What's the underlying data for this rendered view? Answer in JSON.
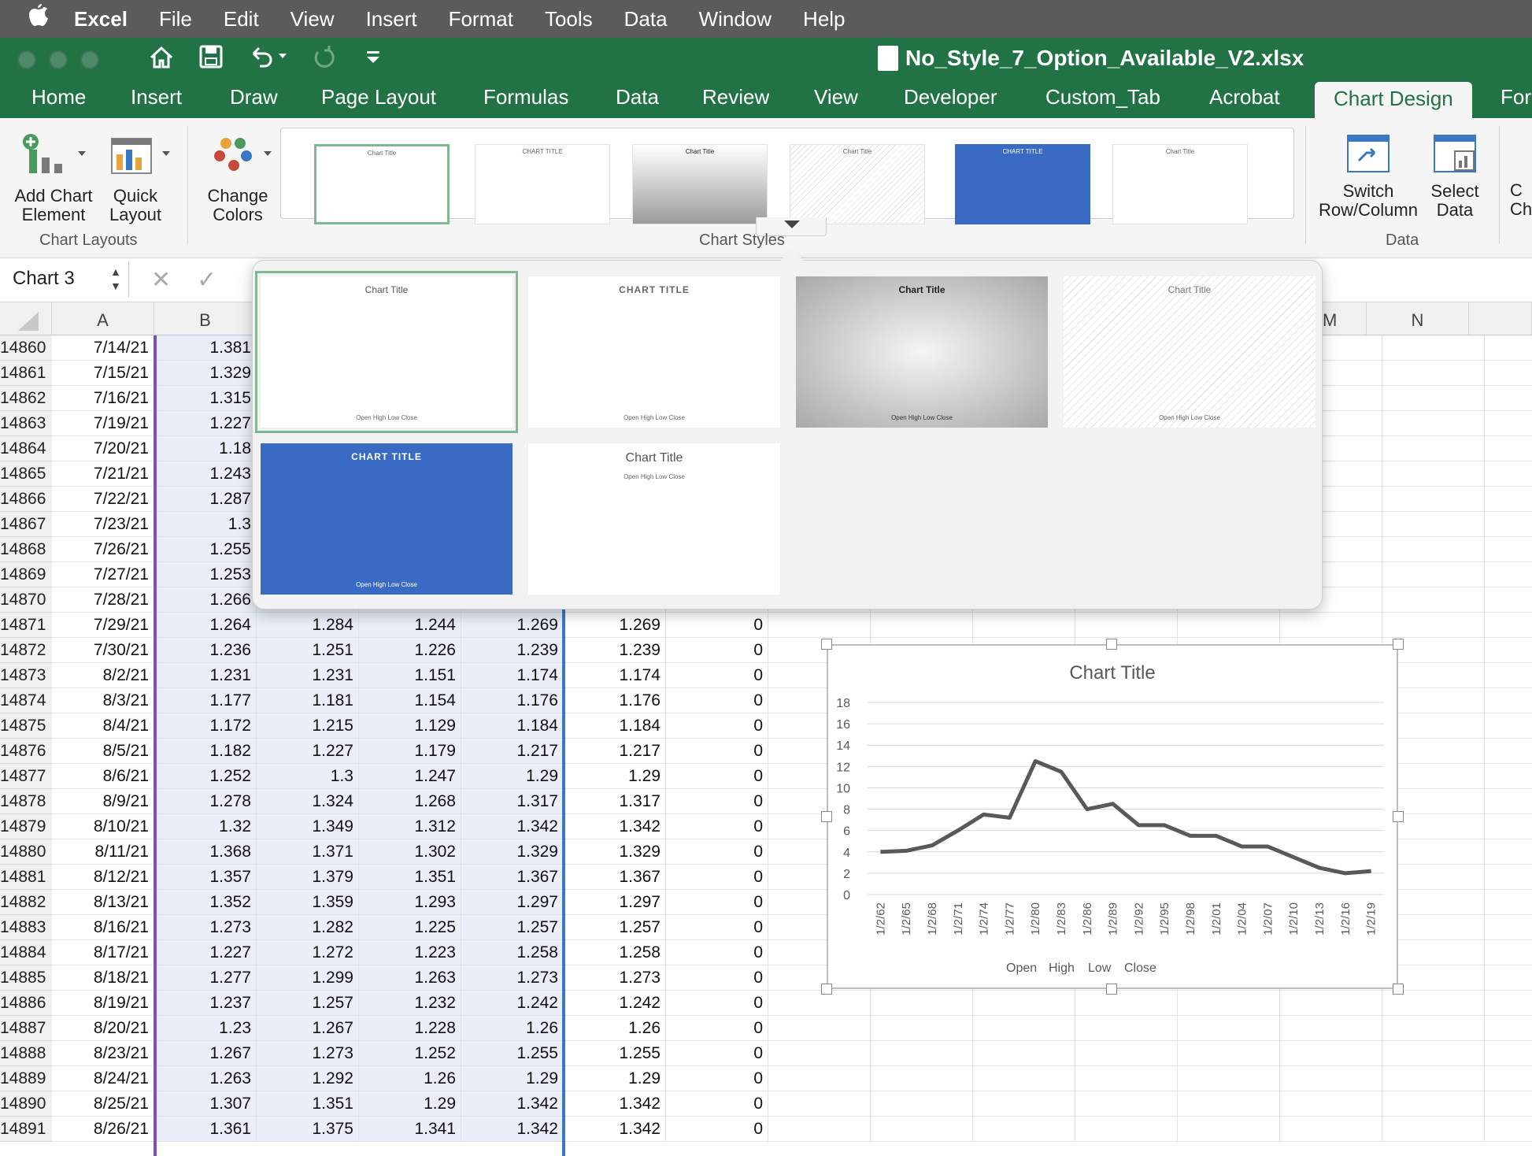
{
  "menubar": {
    "apple": "",
    "items": [
      "Excel",
      "File",
      "Edit",
      "View",
      "Insert",
      "Format",
      "Tools",
      "Data",
      "Window",
      "Help"
    ]
  },
  "titlebar": {
    "doc_title": "No_Style_7_Option_Available_V2.xlsx"
  },
  "tabs": [
    "Home",
    "Insert",
    "Draw",
    "Page Layout",
    "Formulas",
    "Data",
    "Review",
    "View",
    "Developer",
    "Custom_Tab",
    "Acrobat",
    "Chart Design",
    "For"
  ],
  "ribbon": {
    "add_chart_element": "Add Chart Element",
    "quick_layout": "Quick Layout",
    "change_colors": "Change Colors",
    "chart_layouts_label": "Chart Layouts",
    "chart_styles_label": "Chart Styles",
    "switch_row_col": "Switch Row/Column",
    "select_data": "Select Data",
    "data_label": "Data",
    "partial": "C Ch"
  },
  "formula_bar": {
    "name_box": "Chart 3",
    "cancel": "✕",
    "enter": "✓"
  },
  "columns": [
    "A",
    "B",
    "M",
    "N"
  ],
  "rows": [
    {
      "r": "14860",
      "a": "7/14/21",
      "b": "1.381"
    },
    {
      "r": "14861",
      "a": "7/15/21",
      "b": "1.329"
    },
    {
      "r": "14862",
      "a": "7/16/21",
      "b": "1.315"
    },
    {
      "r": "14863",
      "a": "7/19/21",
      "b": "1.227"
    },
    {
      "r": "14864",
      "a": "7/20/21",
      "b": "1.18"
    },
    {
      "r": "14865",
      "a": "7/21/21",
      "b": "1.243"
    },
    {
      "r": "14866",
      "a": "7/22/21",
      "b": "1.287"
    },
    {
      "r": "14867",
      "a": "7/23/21",
      "b": "1.3"
    },
    {
      "r": "14868",
      "a": "7/26/21",
      "b": "1.255"
    },
    {
      "r": "14869",
      "a": "7/27/21",
      "b": "1.253"
    },
    {
      "r": "14870",
      "a": "7/28/21",
      "b": "1.266"
    },
    {
      "r": "14871",
      "a": "7/29/21",
      "b": "1.264",
      "c": "1.284",
      "d": "1.244",
      "e": "1.269",
      "f": "1.269",
      "g": "0"
    },
    {
      "r": "14872",
      "a": "7/30/21",
      "b": "1.236",
      "c": "1.251",
      "d": "1.226",
      "e": "1.239",
      "f": "1.239",
      "g": "0"
    },
    {
      "r": "14873",
      "a": "8/2/21",
      "b": "1.231",
      "c": "1.231",
      "d": "1.151",
      "e": "1.174",
      "f": "1.174",
      "g": "0"
    },
    {
      "r": "14874",
      "a": "8/3/21",
      "b": "1.177",
      "c": "1.181",
      "d": "1.154",
      "e": "1.176",
      "f": "1.176",
      "g": "0"
    },
    {
      "r": "14875",
      "a": "8/4/21",
      "b": "1.172",
      "c": "1.215",
      "d": "1.129",
      "e": "1.184",
      "f": "1.184",
      "g": "0"
    },
    {
      "r": "14876",
      "a": "8/5/21",
      "b": "1.182",
      "c": "1.227",
      "d": "1.179",
      "e": "1.217",
      "f": "1.217",
      "g": "0"
    },
    {
      "r": "14877",
      "a": "8/6/21",
      "b": "1.252",
      "c": "1.3",
      "d": "1.247",
      "e": "1.29",
      "f": "1.29",
      "g": "0"
    },
    {
      "r": "14878",
      "a": "8/9/21",
      "b": "1.278",
      "c": "1.324",
      "d": "1.268",
      "e": "1.317",
      "f": "1.317",
      "g": "0"
    },
    {
      "r": "14879",
      "a": "8/10/21",
      "b": "1.32",
      "c": "1.349",
      "d": "1.312",
      "e": "1.342",
      "f": "1.342",
      "g": "0"
    },
    {
      "r": "14880",
      "a": "8/11/21",
      "b": "1.368",
      "c": "1.371",
      "d": "1.302",
      "e": "1.329",
      "f": "1.329",
      "g": "0"
    },
    {
      "r": "14881",
      "a": "8/12/21",
      "b": "1.357",
      "c": "1.379",
      "d": "1.351",
      "e": "1.367",
      "f": "1.367",
      "g": "0"
    },
    {
      "r": "14882",
      "a": "8/13/21",
      "b": "1.352",
      "c": "1.359",
      "d": "1.293",
      "e": "1.297",
      "f": "1.297",
      "g": "0"
    },
    {
      "r": "14883",
      "a": "8/16/21",
      "b": "1.273",
      "c": "1.282",
      "d": "1.225",
      "e": "1.257",
      "f": "1.257",
      "g": "0"
    },
    {
      "r": "14884",
      "a": "8/17/21",
      "b": "1.227",
      "c": "1.272",
      "d": "1.223",
      "e": "1.258",
      "f": "1.258",
      "g": "0"
    },
    {
      "r": "14885",
      "a": "8/18/21",
      "b": "1.277",
      "c": "1.299",
      "d": "1.263",
      "e": "1.273",
      "f": "1.273",
      "g": "0"
    },
    {
      "r": "14886",
      "a": "8/19/21",
      "b": "1.237",
      "c": "1.257",
      "d": "1.232",
      "e": "1.242",
      "f": "1.242",
      "g": "0"
    },
    {
      "r": "14887",
      "a": "8/20/21",
      "b": "1.23",
      "c": "1.267",
      "d": "1.228",
      "e": "1.26",
      "f": "1.26",
      "g": "0"
    },
    {
      "r": "14888",
      "a": "8/23/21",
      "b": "1.267",
      "c": "1.273",
      "d": "1.252",
      "e": "1.255",
      "f": "1.255",
      "g": "0"
    },
    {
      "r": "14889",
      "a": "8/24/21",
      "b": "1.263",
      "c": "1.292",
      "d": "1.26",
      "e": "1.29",
      "f": "1.29",
      "g": "0"
    },
    {
      "r": "14890",
      "a": "8/25/21",
      "b": "1.307",
      "c": "1.351",
      "d": "1.29",
      "e": "1.342",
      "f": "1.342",
      "g": "0"
    },
    {
      "r": "14891",
      "a": "8/26/21",
      "b": "1.361",
      "c": "1.375",
      "d": "1.341",
      "e": "1.342",
      "f": "1.342",
      "g": "0"
    }
  ],
  "style_thumbs": [
    {
      "title": "Chart Title",
      "variant": "plain"
    },
    {
      "title": "CHART TITLE",
      "variant": "plain"
    },
    {
      "title": "Chart Title",
      "variant": "gray"
    },
    {
      "title": "Chart Title",
      "variant": "hatch"
    },
    {
      "title": "CHART TITLE",
      "variant": "blue"
    },
    {
      "title": "Chart Title",
      "variant": "plain"
    }
  ],
  "thumb_legend": "Open    High    Low    Close",
  "colors": {
    "excel_green": "#217346",
    "blue_style": "#3a6bc4",
    "series": "#595959"
  },
  "chart_data": {
    "type": "line",
    "title": "Chart Title",
    "ylim": [
      0,
      18
    ],
    "yticks": [
      "0",
      "2",
      "4",
      "6",
      "8",
      "10",
      "12",
      "14",
      "16",
      "18"
    ],
    "x": [
      "1/2/62",
      "1/2/65",
      "1/2/68",
      "1/2/71",
      "1/2/74",
      "1/2/77",
      "1/2/80",
      "1/2/83",
      "1/2/86",
      "1/2/89",
      "1/2/92",
      "1/2/95",
      "1/2/98",
      "1/2/01",
      "1/2/04",
      "1/2/07",
      "1/2/10",
      "1/2/13",
      "1/2/16",
      "1/2/19"
    ],
    "legend": [
      "Open",
      "High",
      "Low",
      "Close"
    ],
    "legend_position": "bottom",
    "grid": true,
    "series": [
      {
        "name": "Close",
        "values": [
          4.0,
          4.1,
          4.6,
          6.0,
          7.5,
          7.2,
          12.5,
          11.5,
          8.0,
          8.5,
          6.5,
          6.5,
          5.5,
          5.5,
          4.5,
          4.5,
          3.5,
          2.5,
          2.0,
          2.2
        ]
      }
    ]
  }
}
